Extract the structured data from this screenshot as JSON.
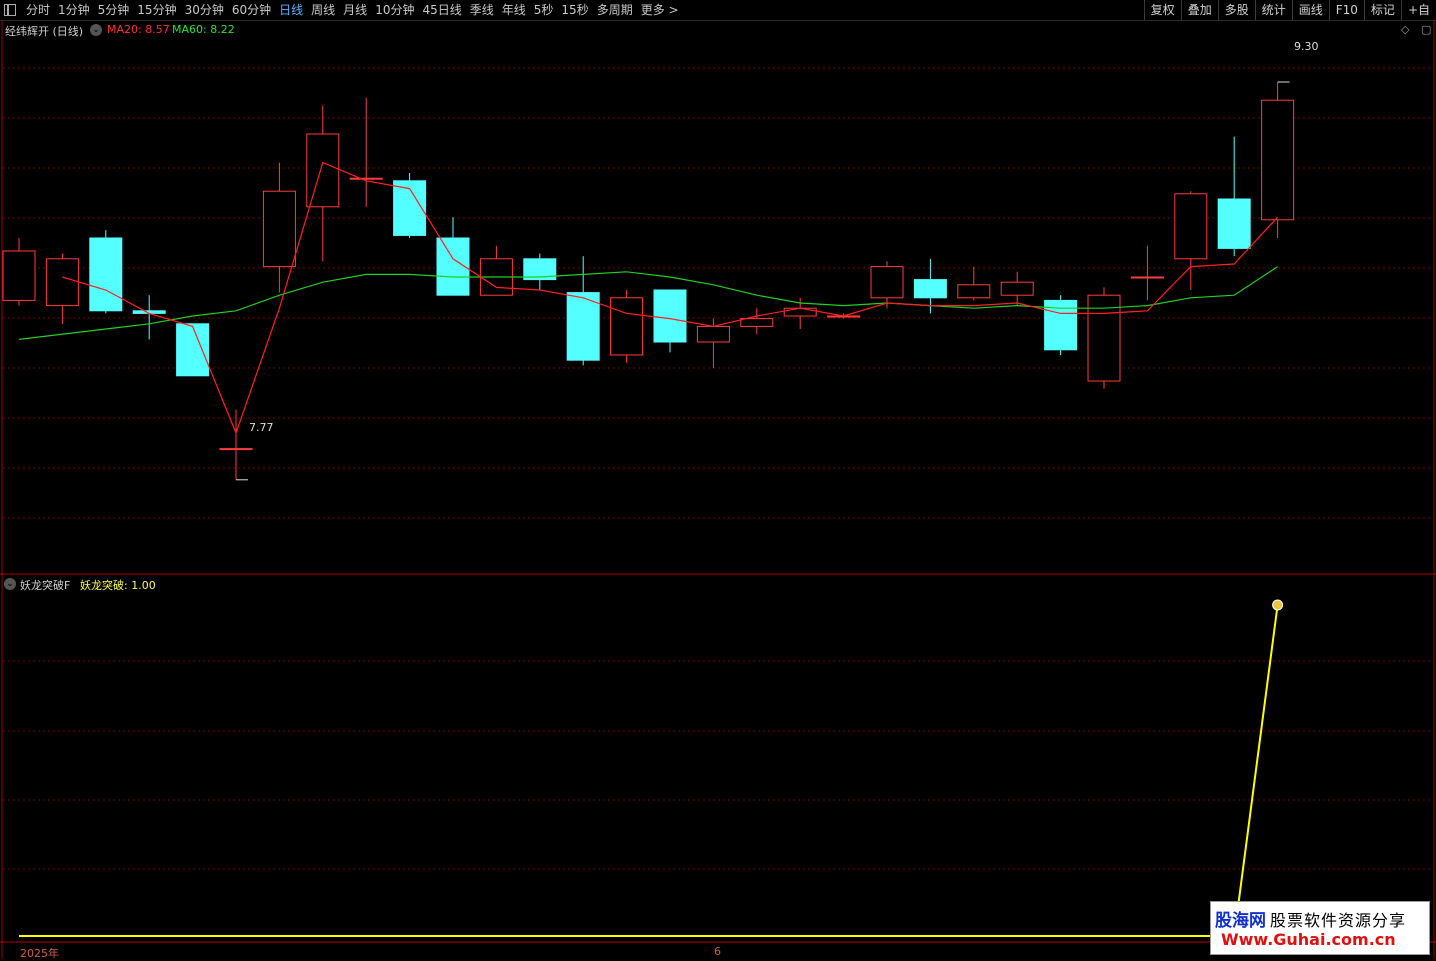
{
  "toolbar": {
    "periods": [
      "分时",
      "1分钟",
      "5分钟",
      "15分钟",
      "30分钟",
      "60分钟",
      "日线",
      "周线",
      "月线",
      "10分钟",
      "45日线",
      "季线",
      "年线",
      "5秒",
      "15秒",
      "多周期",
      "更多 >"
    ],
    "active_period": "日线",
    "buttons": [
      "复权",
      "叠加",
      "多股",
      "统计",
      "画线",
      "F10",
      "标记",
      "+自"
    ]
  },
  "main_panel": {
    "title": "经纬辉开 (日线)",
    "ma20_label": "MA20: 8.57",
    "ma60_label": "MA60: 8.22",
    "high_label": "9.30",
    "low_label": "7.77"
  },
  "indicator_panel": {
    "name": "妖龙突破F",
    "value_label": "妖龙突破: 1.00"
  },
  "xaxis": {
    "year_label": "2025年",
    "month_label": "6"
  },
  "colors": {
    "up": "#ff3c3c",
    "down": "#54ffff",
    "ma20": "#ff2020",
    "ma60": "#20d020",
    "signal": "#ffff00",
    "grid": "#7a0000"
  },
  "watermark": {
    "brand": "股海网",
    "tagline": "股票软件资源分享",
    "url": "Www.Guhai.com.cn"
  },
  "chart_data": {
    "type": "candlestick",
    "ylim": [
      7.5,
      9.45
    ],
    "candles": [
      {
        "o": 8.46,
        "c": 8.65,
        "h": 8.7,
        "l": 8.44
      },
      {
        "o": 8.44,
        "c": 8.62,
        "h": 8.64,
        "l": 8.37
      },
      {
        "o": 8.7,
        "c": 8.42,
        "h": 8.73,
        "l": 8.41
      },
      {
        "o": 8.42,
        "c": 8.41,
        "h": 8.48,
        "l": 8.31
      },
      {
        "o": 8.37,
        "c": 8.17,
        "h": 8.37,
        "l": 8.17
      },
      {
        "o": 7.89,
        "c": 7.89,
        "h": 8.04,
        "l": 7.77
      },
      {
        "o": 8.59,
        "c": 8.88,
        "h": 8.99,
        "l": 8.49
      },
      {
        "o": 8.82,
        "c": 9.1,
        "h": 9.21,
        "l": 8.61
      },
      {
        "o": 8.93,
        "c": 8.93,
        "h": 9.24,
        "l": 8.82
      },
      {
        "o": 8.92,
        "c": 8.71,
        "h": 8.95,
        "l": 8.7
      },
      {
        "o": 8.7,
        "c": 8.48,
        "h": 8.78,
        "l": 8.48
      },
      {
        "o": 8.48,
        "c": 8.62,
        "h": 8.67,
        "l": 8.48
      },
      {
        "o": 8.62,
        "c": 8.54,
        "h": 8.64,
        "l": 8.5
      },
      {
        "o": 8.49,
        "c": 8.23,
        "h": 8.63,
        "l": 8.21
      },
      {
        "o": 8.25,
        "c": 8.47,
        "h": 8.5,
        "l": 8.22
      },
      {
        "o": 8.5,
        "c": 8.3,
        "h": 8.5,
        "l": 8.26
      },
      {
        "o": 8.3,
        "c": 8.36,
        "h": 8.39,
        "l": 8.2
      },
      {
        "o": 8.36,
        "c": 8.39,
        "h": 8.43,
        "l": 8.33
      },
      {
        "o": 8.4,
        "c": 8.43,
        "h": 8.47,
        "l": 8.35
      },
      {
        "o": 8.4,
        "c": 8.4,
        "h": 8.41,
        "l": 8.39
      },
      {
        "o": 8.47,
        "c": 8.59,
        "h": 8.61,
        "l": 8.43
      },
      {
        "o": 8.54,
        "c": 8.47,
        "h": 8.62,
        "l": 8.41
      },
      {
        "o": 8.47,
        "c": 8.52,
        "h": 8.59,
        "l": 8.46
      },
      {
        "o": 8.48,
        "c": 8.53,
        "h": 8.57,
        "l": 8.44
      },
      {
        "o": 8.46,
        "c": 8.27,
        "h": 8.48,
        "l": 8.25
      },
      {
        "o": 8.15,
        "c": 8.48,
        "h": 8.51,
        "l": 8.12
      },
      {
        "o": 8.55,
        "c": 8.55,
        "h": 8.67,
        "l": 8.46
      },
      {
        "o": 8.62,
        "c": 8.87,
        "h": 8.88,
        "l": 8.5
      },
      {
        "o": 8.85,
        "c": 8.66,
        "h": 9.09,
        "l": 8.63
      },
      {
        "o": 8.77,
        "c": 9.23,
        "h": 9.3,
        "l": 8.7
      }
    ],
    "ma20": [
      null,
      8.55,
      8.5,
      8.41,
      8.36,
      7.95,
      8.43,
      8.99,
      8.92,
      8.89,
      8.62,
      8.51,
      8.5,
      8.47,
      8.41,
      8.39,
      8.36,
      8.4,
      8.43,
      8.4,
      8.45,
      8.44,
      8.44,
      8.45,
      8.41,
      8.41,
      8.42,
      8.59,
      8.6,
      8.78
    ],
    "ma60": [
      8.31,
      null,
      8.35,
      8.37,
      8.4,
      8.42,
      8.48,
      8.53,
      8.56,
      8.56,
      8.55,
      8.55,
      8.55,
      8.56,
      8.57,
      8.55,
      8.52,
      8.48,
      8.45,
      8.44,
      8.45,
      8.44,
      8.43,
      8.44,
      8.43,
      8.43,
      8.44,
      8.47,
      8.48,
      8.59
    ],
    "signal": [
      0,
      0,
      0,
      0,
      0,
      0,
      0,
      0,
      0,
      0,
      0,
      0,
      0,
      0,
      0,
      0,
      0,
      0,
      0,
      0,
      0,
      0,
      0,
      0,
      0,
      0,
      0,
      0,
      0,
      1
    ],
    "signal_ylim": [
      0,
      1
    ]
  }
}
